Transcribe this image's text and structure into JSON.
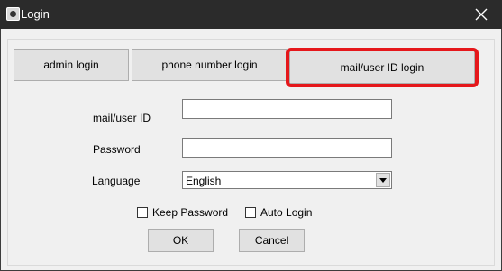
{
  "window": {
    "title": "Login",
    "app_icon": "app-icon",
    "close_icon": "close-icon"
  },
  "login_modes": {
    "admin_label": "admin login",
    "phone_label": "phone number login",
    "mail_label": "mail/user ID login",
    "selected": "mail/user ID login",
    "highlight_color": "#e5171b"
  },
  "form": {
    "userid_label": "mail/user ID",
    "userid_value": "",
    "password_label": "Password",
    "password_value": "",
    "language_label": "Language",
    "language_value": "English"
  },
  "options": {
    "keep_password_label": "Keep Password",
    "keep_password_checked": false,
    "auto_login_label": "Auto Login",
    "auto_login_checked": false
  },
  "actions": {
    "ok_label": "OK",
    "cancel_label": "Cancel"
  }
}
